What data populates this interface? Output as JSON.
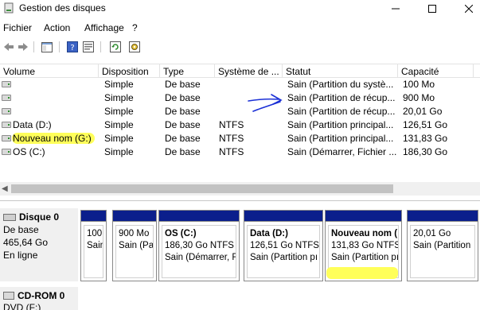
{
  "window": {
    "title": "Gestion des disques"
  },
  "menu": [
    "Fichier",
    "Action",
    "Affichage",
    "?"
  ],
  "list": {
    "headers": [
      "Volume",
      "Disposition",
      "Type",
      "Système de ...",
      "Statut",
      "Capacité"
    ],
    "rows": [
      {
        "volume": "",
        "disposition": "Simple",
        "type": "De base",
        "fs": "",
        "statut": "Sain (Partition du systè...",
        "capacite": "100 Mo"
      },
      {
        "volume": "",
        "disposition": "Simple",
        "type": "De base",
        "fs": "",
        "statut": "Sain (Partition de récup...",
        "capacite": "900 Mo"
      },
      {
        "volume": "",
        "disposition": "Simple",
        "type": "De base",
        "fs": "",
        "statut": "Sain (Partition de récup...",
        "capacite": "20,01 Go"
      },
      {
        "volume": "Data (D:)",
        "disposition": "Simple",
        "type": "De base",
        "fs": "NTFS",
        "statut": "Sain (Partition principal...",
        "capacite": "126,51 Go"
      },
      {
        "volume": "Nouveau nom (G:)",
        "disposition": "Simple",
        "type": "De base",
        "fs": "NTFS",
        "statut": "Sain (Partition principal...",
        "capacite": "131,83 Go"
      },
      {
        "volume": "OS (C:)",
        "disposition": "Simple",
        "type": "De base",
        "fs": "NTFS",
        "statut": "Sain (Démarrer, Fichier ...",
        "capacite": "186,30 Go"
      }
    ]
  },
  "disk0": {
    "name": "Disque 0",
    "type": "De base",
    "size": "465,64 Go",
    "status": "En ligne",
    "partitions": [
      {
        "name": "",
        "size": "100 M",
        "status": "Sain"
      },
      {
        "name": "",
        "size": "900 Mo",
        "status": "Sain (Pa"
      },
      {
        "name": "OS (C:)",
        "size": "186,30 Go NTFS",
        "status": "Sain (Démarrer, F"
      },
      {
        "name": "Data (D:)",
        "size": "126,51 Go NTFS",
        "status": "Sain (Partition pı"
      },
      {
        "name": "Nouveau nom (",
        "size": "131,83 Go NTFS",
        "status": "Sain (Partition pı"
      },
      {
        "name": "",
        "size": "20,01 Go",
        "status": "Sain (Partition"
      }
    ]
  },
  "cdrom0": {
    "name": "CD-ROM 0",
    "drive": "DVD (F:)"
  },
  "colors": {
    "partition_bar": "#0b1f8c",
    "highlight": "#ffff5a",
    "annotation_arrow": "#1a2fd6"
  }
}
